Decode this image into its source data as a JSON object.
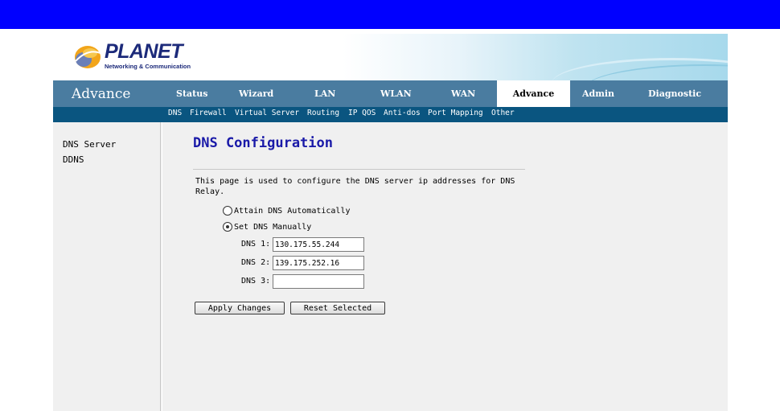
{
  "logo": {
    "brand": "PLANET",
    "tagline": "Networking & Communication"
  },
  "nav": {
    "title": "Advance",
    "items": [
      {
        "label": "Status"
      },
      {
        "label": "Wizard"
      },
      {
        "label": "LAN"
      },
      {
        "label": "WLAN"
      },
      {
        "label": "WAN"
      },
      {
        "label": "Advance",
        "active": true
      },
      {
        "label": "Admin"
      },
      {
        "label": "Diagnostic"
      }
    ]
  },
  "subnav": [
    "DNS",
    "Firewall",
    "Virtual Server",
    "Routing",
    "IP QOS",
    "Anti-dos",
    "Port Mapping",
    "Other"
  ],
  "sidebar": [
    "DNS Server",
    "DDNS"
  ],
  "main": {
    "title": "DNS Configuration",
    "description": "This page is used to configure the DNS server ip addresses for DNS Relay.",
    "radio_auto": "Attain DNS Automatically",
    "radio_manual": "Set DNS Manually",
    "radio_selected": "manual",
    "dns": [
      {
        "label": "DNS 1:",
        "value": "130.175.55.244"
      },
      {
        "label": "DNS 2:",
        "value": "139.175.252.16"
      },
      {
        "label": "DNS 3:",
        "value": ""
      }
    ],
    "apply_label": "Apply Changes",
    "reset_label": "Reset Selected"
  },
  "colors": {
    "top_bar": "#0000ff",
    "nav_bg": "#4a7ca0",
    "subnav_bg": "#0a5580",
    "title": "#1a1aa8"
  }
}
